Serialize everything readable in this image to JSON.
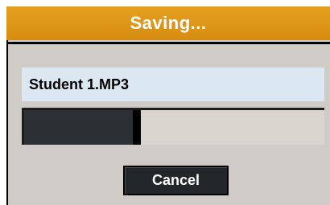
{
  "dialog": {
    "title": "Saving...",
    "filename": "Student 1.MP3",
    "progress": 0.39,
    "cancel_label": "Cancel"
  },
  "colors": {
    "titlebar": "#d68d10",
    "title_text": "#ffffff",
    "dialog_background": "#cfccc7",
    "filename_background": "#dce8f1",
    "progress_fill": "#2c3034",
    "progress_track": "#d9d4ce",
    "button_background": "#23272a"
  }
}
